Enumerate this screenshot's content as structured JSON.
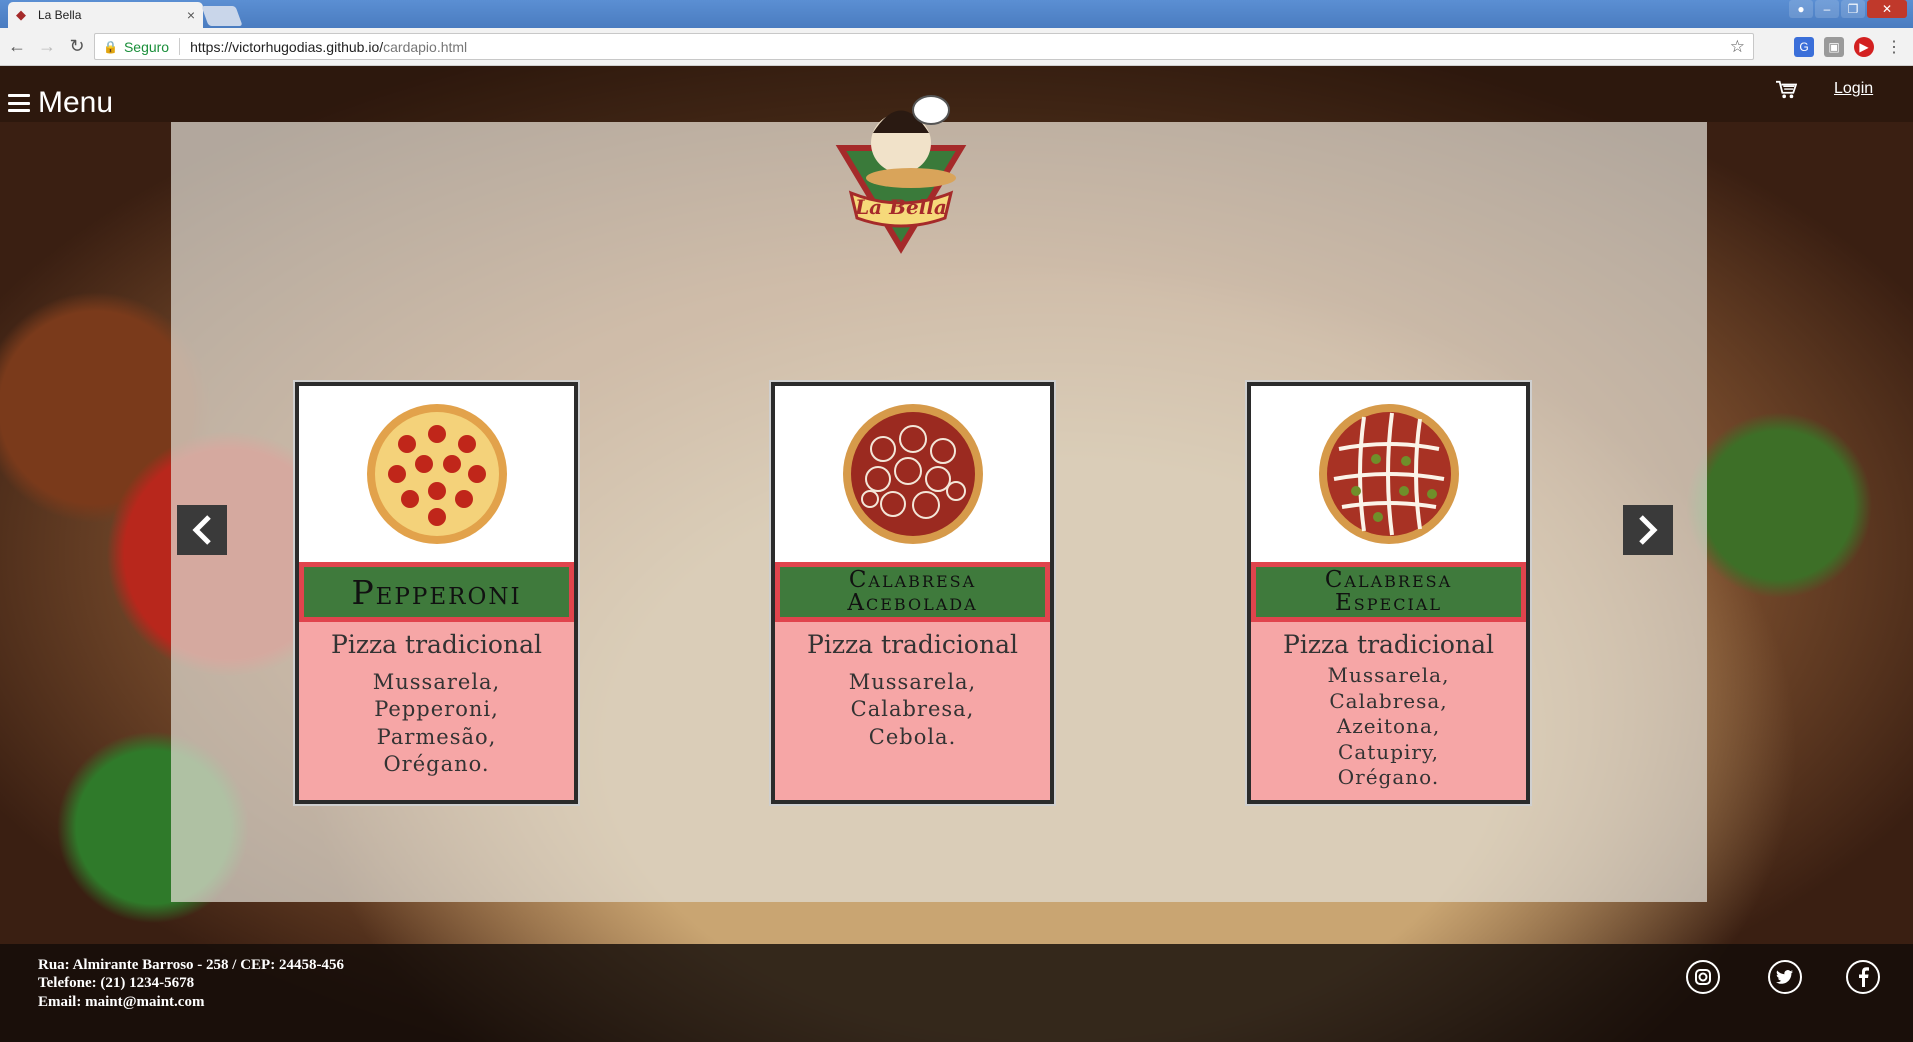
{
  "browser": {
    "tab_title": "La Bella",
    "tab_close": "×",
    "secure_label": "Seguro",
    "url_base": "https://victorhugodias.github.io/",
    "url_path": "cardapio.html"
  },
  "header": {
    "menu_label": "Menu",
    "login_label": "Login"
  },
  "logo": {
    "text": "La Bella"
  },
  "carousel": {
    "cards": [
      {
        "name_line1": "Pepperoni",
        "name_line2": "",
        "kind": "Pizza tradicional",
        "ingredients": [
          "Mussarela,",
          "Pepperoni,",
          "Parmesão,",
          "Orégano."
        ]
      },
      {
        "name_line1": "Calabresa",
        "name_line2": "Acebolada",
        "kind": "Pizza tradicional",
        "ingredients": [
          "Mussarela,",
          "Calabresa,",
          "Cebola."
        ]
      },
      {
        "name_line1": "Calabresa",
        "name_line2": "Especial",
        "kind": "Pizza tradicional",
        "ingredients": [
          "Mussarela,",
          "Calabresa,",
          "Azeitona,",
          "Catupiry,",
          "Orégano."
        ]
      }
    ]
  },
  "footer": {
    "address": "Rua: Almirante Barroso - 258 / CEP: 24458-456",
    "phone": "Telefone: (21) 1234-5678",
    "email": "Email: maint@maint.com"
  },
  "colors": {
    "card_title_bg": "#3f7a3c",
    "card_border": "#e0444d",
    "card_body_bg": "#f6a6a6"
  }
}
